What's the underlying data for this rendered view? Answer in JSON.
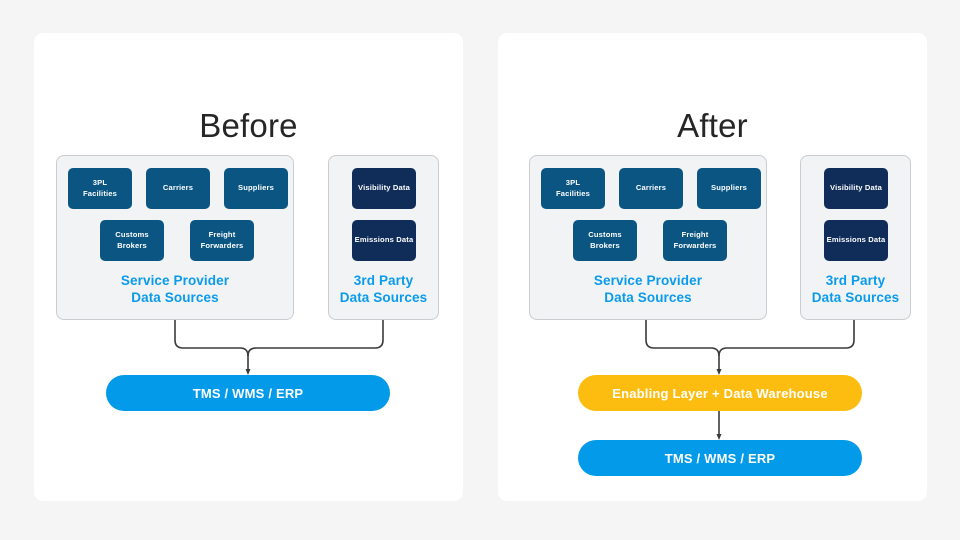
{
  "page": {
    "background": "#f5f5f6"
  },
  "colors": {
    "service_provider_tile": "#0b5583",
    "third_party_tile": "#0f2d58",
    "accent_blue": "#039be9",
    "accent_amber": "#fdbd10",
    "label_blue": "#0a9bec",
    "panel_background": "#ffffff",
    "group_background": "#f2f3f4"
  },
  "panels": [
    {
      "id": "before",
      "title": "Before",
      "groups": [
        {
          "id": "service-provider",
          "label_line1": "Service Provider",
          "label_line2": "Data Sources",
          "tiles": [
            {
              "label_line1": "3PL",
              "label_line2": "Facilities"
            },
            {
              "label_line1": "Carriers",
              "label_line2": ""
            },
            {
              "label_line1": "Suppliers",
              "label_line2": ""
            },
            {
              "label_line1": "Customs Brokers",
              "label_line2": ""
            },
            {
              "label_line1": "Freight",
              "label_line2": "Forwarders"
            }
          ]
        },
        {
          "id": "third-party",
          "label_line1": "3rd Party",
          "label_line2": "Data Sources",
          "tiles": [
            {
              "label_line1": "Visibility Data",
              "label_line2": ""
            },
            {
              "label_line1": "Emissions Data",
              "label_line2": ""
            }
          ]
        }
      ],
      "bars": [
        {
          "id": "tms-wms-erp",
          "label": "TMS / WMS / ERP",
          "color": "#039be9"
        }
      ]
    },
    {
      "id": "after",
      "title": "After",
      "groups": [
        {
          "id": "service-provider",
          "label_line1": "Service Provider",
          "label_line2": "Data Sources",
          "tiles": [
            {
              "label_line1": "3PL",
              "label_line2": "Facilities"
            },
            {
              "label_line1": "Carriers",
              "label_line2": ""
            },
            {
              "label_line1": "Suppliers",
              "label_line2": ""
            },
            {
              "label_line1": "Customs Brokers",
              "label_line2": ""
            },
            {
              "label_line1": "Freight",
              "label_line2": "Forwarders"
            }
          ]
        },
        {
          "id": "third-party",
          "label_line1": "3rd Party",
          "label_line2": "Data Sources",
          "tiles": [
            {
              "label_line1": "Visibility Data",
              "label_line2": ""
            },
            {
              "label_line1": "Emissions Data",
              "label_line2": ""
            }
          ]
        }
      ],
      "bars": [
        {
          "id": "enabling-layer",
          "label": "Enabling Layer + Data Warehouse",
          "color": "#fdbd10"
        },
        {
          "id": "tms-wms-erp",
          "label": "TMS / WMS / ERP",
          "color": "#039be9"
        }
      ]
    }
  ]
}
